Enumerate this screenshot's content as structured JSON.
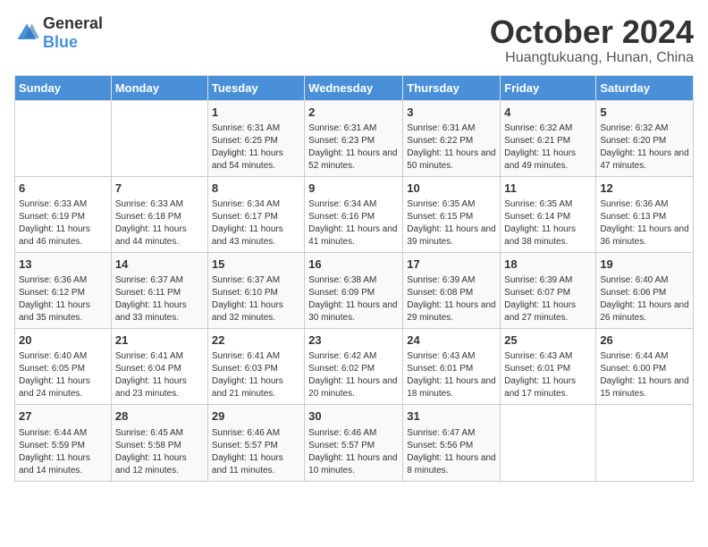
{
  "logo": {
    "general": "General",
    "blue": "Blue"
  },
  "title": "October 2024",
  "subtitle": "Huangtukuang, Hunan, China",
  "days_of_week": [
    "Sunday",
    "Monday",
    "Tuesday",
    "Wednesday",
    "Thursday",
    "Friday",
    "Saturday"
  ],
  "weeks": [
    [
      {
        "day": "",
        "info": ""
      },
      {
        "day": "",
        "info": ""
      },
      {
        "day": "1",
        "info": "Sunrise: 6:31 AM\nSunset: 6:25 PM\nDaylight: 11 hours and 54 minutes."
      },
      {
        "day": "2",
        "info": "Sunrise: 6:31 AM\nSunset: 6:23 PM\nDaylight: 11 hours and 52 minutes."
      },
      {
        "day": "3",
        "info": "Sunrise: 6:31 AM\nSunset: 6:22 PM\nDaylight: 11 hours and 50 minutes."
      },
      {
        "day": "4",
        "info": "Sunrise: 6:32 AM\nSunset: 6:21 PM\nDaylight: 11 hours and 49 minutes."
      },
      {
        "day": "5",
        "info": "Sunrise: 6:32 AM\nSunset: 6:20 PM\nDaylight: 11 hours and 47 minutes."
      }
    ],
    [
      {
        "day": "6",
        "info": "Sunrise: 6:33 AM\nSunset: 6:19 PM\nDaylight: 11 hours and 46 minutes."
      },
      {
        "day": "7",
        "info": "Sunrise: 6:33 AM\nSunset: 6:18 PM\nDaylight: 11 hours and 44 minutes."
      },
      {
        "day": "8",
        "info": "Sunrise: 6:34 AM\nSunset: 6:17 PM\nDaylight: 11 hours and 43 minutes."
      },
      {
        "day": "9",
        "info": "Sunrise: 6:34 AM\nSunset: 6:16 PM\nDaylight: 11 hours and 41 minutes."
      },
      {
        "day": "10",
        "info": "Sunrise: 6:35 AM\nSunset: 6:15 PM\nDaylight: 11 hours and 39 minutes."
      },
      {
        "day": "11",
        "info": "Sunrise: 6:35 AM\nSunset: 6:14 PM\nDaylight: 11 hours and 38 minutes."
      },
      {
        "day": "12",
        "info": "Sunrise: 6:36 AM\nSunset: 6:13 PM\nDaylight: 11 hours and 36 minutes."
      }
    ],
    [
      {
        "day": "13",
        "info": "Sunrise: 6:36 AM\nSunset: 6:12 PM\nDaylight: 11 hours and 35 minutes."
      },
      {
        "day": "14",
        "info": "Sunrise: 6:37 AM\nSunset: 6:11 PM\nDaylight: 11 hours and 33 minutes."
      },
      {
        "day": "15",
        "info": "Sunrise: 6:37 AM\nSunset: 6:10 PM\nDaylight: 11 hours and 32 minutes."
      },
      {
        "day": "16",
        "info": "Sunrise: 6:38 AM\nSunset: 6:09 PM\nDaylight: 11 hours and 30 minutes."
      },
      {
        "day": "17",
        "info": "Sunrise: 6:39 AM\nSunset: 6:08 PM\nDaylight: 11 hours and 29 minutes."
      },
      {
        "day": "18",
        "info": "Sunrise: 6:39 AM\nSunset: 6:07 PM\nDaylight: 11 hours and 27 minutes."
      },
      {
        "day": "19",
        "info": "Sunrise: 6:40 AM\nSunset: 6:06 PM\nDaylight: 11 hours and 26 minutes."
      }
    ],
    [
      {
        "day": "20",
        "info": "Sunrise: 6:40 AM\nSunset: 6:05 PM\nDaylight: 11 hours and 24 minutes."
      },
      {
        "day": "21",
        "info": "Sunrise: 6:41 AM\nSunset: 6:04 PM\nDaylight: 11 hours and 23 minutes."
      },
      {
        "day": "22",
        "info": "Sunrise: 6:41 AM\nSunset: 6:03 PM\nDaylight: 11 hours and 21 minutes."
      },
      {
        "day": "23",
        "info": "Sunrise: 6:42 AM\nSunset: 6:02 PM\nDaylight: 11 hours and 20 minutes."
      },
      {
        "day": "24",
        "info": "Sunrise: 6:43 AM\nSunset: 6:01 PM\nDaylight: 11 hours and 18 minutes."
      },
      {
        "day": "25",
        "info": "Sunrise: 6:43 AM\nSunset: 6:01 PM\nDaylight: 11 hours and 17 minutes."
      },
      {
        "day": "26",
        "info": "Sunrise: 6:44 AM\nSunset: 6:00 PM\nDaylight: 11 hours and 15 minutes."
      }
    ],
    [
      {
        "day": "27",
        "info": "Sunrise: 6:44 AM\nSunset: 5:59 PM\nDaylight: 11 hours and 14 minutes."
      },
      {
        "day": "28",
        "info": "Sunrise: 6:45 AM\nSunset: 5:58 PM\nDaylight: 11 hours and 12 minutes."
      },
      {
        "day": "29",
        "info": "Sunrise: 6:46 AM\nSunset: 5:57 PM\nDaylight: 11 hours and 11 minutes."
      },
      {
        "day": "30",
        "info": "Sunrise: 6:46 AM\nSunset: 5:57 PM\nDaylight: 11 hours and 10 minutes."
      },
      {
        "day": "31",
        "info": "Sunrise: 6:47 AM\nSunset: 5:56 PM\nDaylight: 11 hours and 8 minutes."
      },
      {
        "day": "",
        "info": ""
      },
      {
        "day": "",
        "info": ""
      }
    ]
  ]
}
